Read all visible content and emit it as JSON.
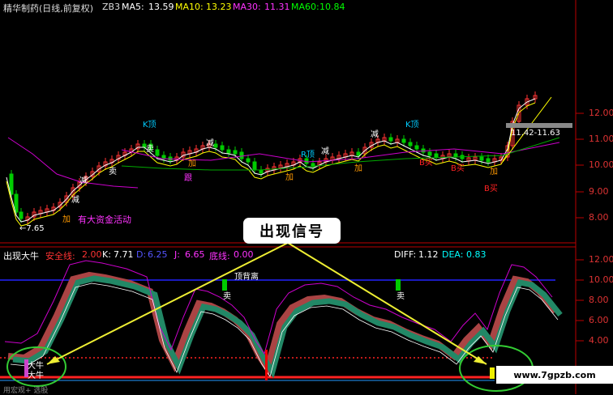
{
  "header": {
    "title": "精华制药(日线,前复权)",
    "formula": "ZB3",
    "ma5_label": "MA5:",
    "ma5": "13.59",
    "ma10_label": "MA10:",
    "ma10": "13.23",
    "ma30_label": "MA30:",
    "ma30": "11.31",
    "ma60_label": "MA60:",
    "ma60": "10.84"
  },
  "price_panel": {
    "y_ticks": [
      "12.00",
      "11.00",
      "10.00",
      "9.00",
      "8.00"
    ],
    "low_marker": "←7.65",
    "price_box": "11.42-11.63",
    "annotations": {
      "k_top_1": "K顶",
      "k_top_2": "K顶",
      "r_top": "R顶",
      "sell_1": "卖",
      "sell_2": "卖",
      "reduce_1": "减",
      "reduce_2": "减",
      "reduce_3": "减",
      "reduce_4": "减",
      "reduce_5": "减",
      "add_1": "加",
      "add_2": "加",
      "add_3": "加",
      "add_4": "加",
      "add_5": "加",
      "hold": "跟",
      "buy_1": "B买",
      "buy_2": "B买",
      "buy_3": "B买",
      "big_money": "有大资金活动"
    }
  },
  "indicator_panel": {
    "name": "出现大牛",
    "safe_label": "安全线:",
    "safe": "2.00",
    "k_label": "K:",
    "k": "7.71",
    "d_label": "D:",
    "d": "6.25",
    "j_label": "J:",
    "j": "6.65",
    "bottom_label": "底线:",
    "bottom": "0.00",
    "diff_label": "DIFF:",
    "diff": "1.12",
    "dea_label": "DEA:",
    "dea": "0.83",
    "y_ticks": [
      "12.00",
      "10.00",
      "8.00",
      "6.00",
      "4.00"
    ],
    "top_divergence": "顶背离",
    "sell_1": "卖",
    "sell_2": "卖",
    "bull_1": "大牛",
    "bull_2": "大牛"
  },
  "callout": "出现信号",
  "watermark": "www.7gpzb.com",
  "footer_text": "用宏观+ 选股"
}
